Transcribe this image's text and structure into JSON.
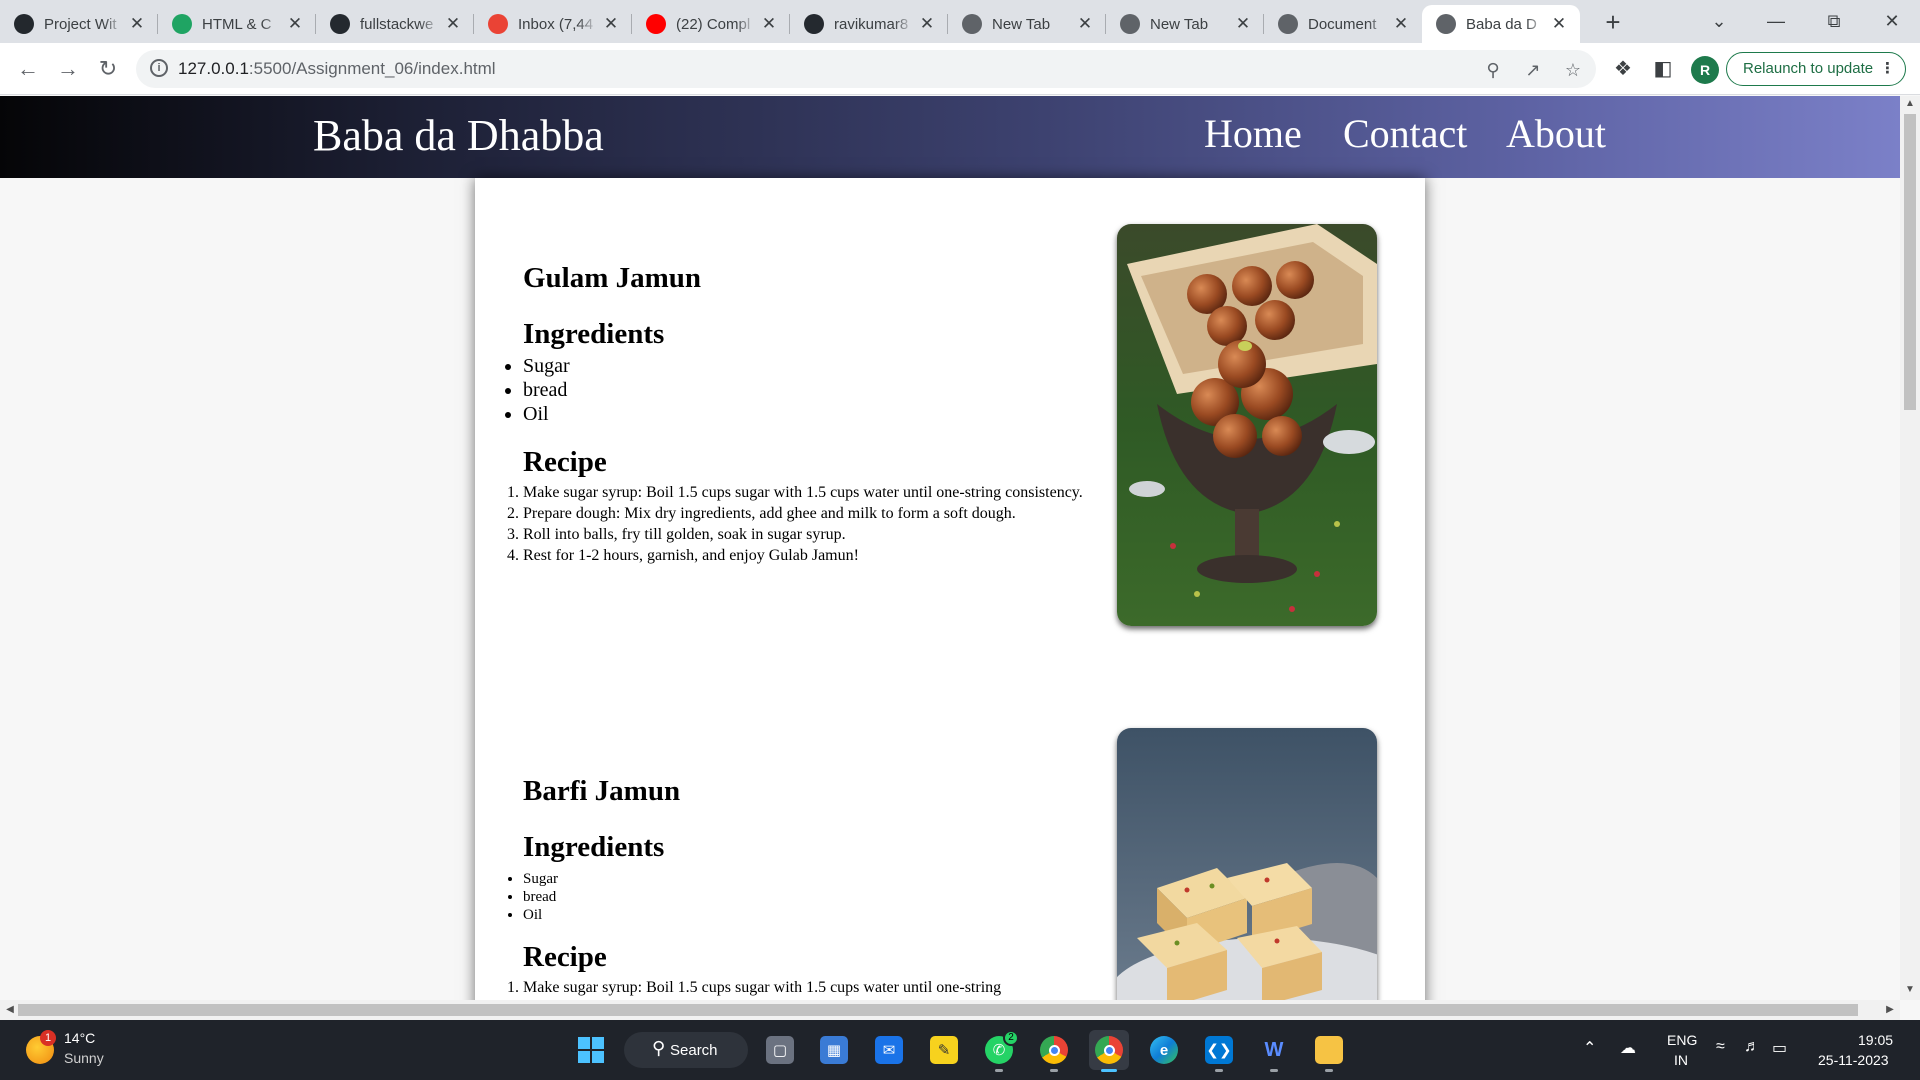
{
  "browser": {
    "tabs": [
      {
        "title": "Project Wit",
        "favicon": "wordpress-icon",
        "color": "#23282d"
      },
      {
        "title": "HTML & C",
        "favicon": "google-drive-icon",
        "color": "#1fa463"
      },
      {
        "title": "fullstackwe",
        "favicon": "github-icon",
        "color": "#24292f"
      },
      {
        "title": "Inbox (7,44",
        "favicon": "gmail-icon",
        "color": "#ea4335"
      },
      {
        "title": "(22) Compl",
        "favicon": "youtube-icon",
        "color": "#ff0000"
      },
      {
        "title": "ravikumar8",
        "favicon": "github-icon",
        "color": "#24292f"
      },
      {
        "title": "New Tab",
        "favicon": "chrome-icon",
        "color": "#5f6368"
      },
      {
        "title": "New Tab",
        "favicon": "chrome-icon",
        "color": "#5f6368"
      },
      {
        "title": "Document",
        "favicon": "globe-icon",
        "color": "#5f6368"
      },
      {
        "title": "Baba da D",
        "favicon": "globe-icon",
        "color": "#5f6368"
      }
    ],
    "active_tab_index": 9,
    "url_host": "127.0.0.1",
    "url_rest": ":5500/Assignment_06/index.html",
    "profile_initial": "R",
    "relaunch_label": "Relaunch to update",
    "accent": "#1e7a4c"
  },
  "site": {
    "title": "Baba da Dhabba",
    "nav": [
      "Home",
      "Contact",
      "About"
    ],
    "header_gradient": [
      "#050507",
      "#7b80c8"
    ]
  },
  "recipes": [
    {
      "name": "Gulam Jamun",
      "ingredients_heading": "Ingredients",
      "ingredients": [
        "Sugar",
        "bread",
        "Oil"
      ],
      "recipe_heading": "Recipe",
      "steps": [
        "Make sugar syrup: Boil 1.5 cups sugar with 1.5 cups water until one-string consistency.",
        "Prepare dough: Mix dry ingredients, add ghee and milk to form a soft dough.",
        "Roll into balls, fry till golden, soak in sugar syrup.",
        "Rest for 1-2 hours, garnish, and enjoy Gulab Jamun!"
      ],
      "image": "gulab-jamun-photo"
    },
    {
      "name": "Barfi Jamun",
      "ingredients_heading": "Ingredients",
      "ingredients": [
        "Sugar",
        "bread",
        "Oil"
      ],
      "recipe_heading": "Recipe",
      "steps": [
        "Make sugar syrup: Boil 1.5 cups sugar with 1.5 cups water until one-string"
      ],
      "image": "barfi-photo"
    }
  ],
  "taskbar": {
    "weather_temp": "14°C",
    "weather_desc": "Sunny",
    "weather_badge": "1",
    "search_label": "Search",
    "whatsapp_badge": "2",
    "lang_1": "ENG",
    "lang_2": "IN",
    "time": "19:05",
    "date": "25-11-2023"
  }
}
